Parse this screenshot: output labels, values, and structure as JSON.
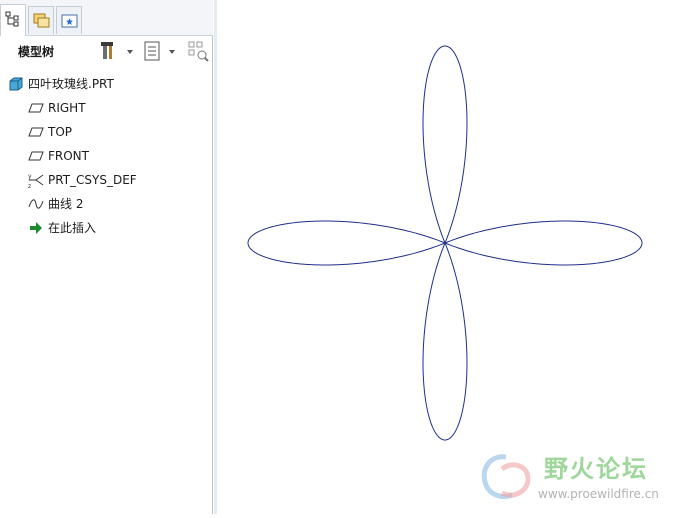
{
  "tabs": [
    {
      "icon": "model-tree-tab-icon"
    },
    {
      "icon": "folder-browser-tab-icon"
    },
    {
      "icon": "favorites-tab-icon"
    }
  ],
  "panel": {
    "title": "模型树",
    "tools": [
      "settings-tools-icon",
      "show-options-icon",
      "filter-icon"
    ]
  },
  "tree": {
    "root": {
      "label": "四叶玫瑰线.PRT",
      "icon": "part-cube-icon"
    },
    "items": [
      {
        "label": "RIGHT",
        "icon": "datum-plane-icon"
      },
      {
        "label": "TOP",
        "icon": "datum-plane-icon"
      },
      {
        "label": "FRONT",
        "icon": "datum-plane-icon"
      },
      {
        "label": "PRT_CSYS_DEF",
        "icon": "coordinate-system-icon"
      },
      {
        "label": "曲线 2",
        "icon": "datum-curve-icon"
      },
      {
        "label": "在此插入",
        "icon": "insert-here-arrow-icon"
      }
    ]
  },
  "curve": {
    "type": "four-leaf rose",
    "color": "#1f2f8a"
  },
  "watermark": {
    "name": "野火论坛",
    "url": "www.proewildfire.cn"
  }
}
